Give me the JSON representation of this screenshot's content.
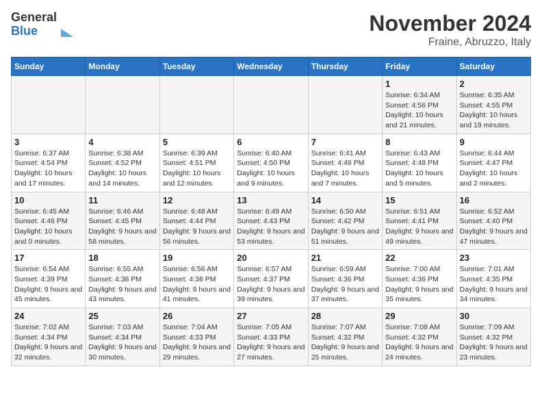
{
  "header": {
    "logo_general": "General",
    "logo_blue": "Blue",
    "title": "November 2024",
    "subtitle": "Fraine, Abruzzo, Italy"
  },
  "calendar": {
    "days_of_week": [
      "Sunday",
      "Monday",
      "Tuesday",
      "Wednesday",
      "Thursday",
      "Friday",
      "Saturday"
    ],
    "weeks": [
      [
        {
          "day": "",
          "info": ""
        },
        {
          "day": "",
          "info": ""
        },
        {
          "day": "",
          "info": ""
        },
        {
          "day": "",
          "info": ""
        },
        {
          "day": "",
          "info": ""
        },
        {
          "day": "1",
          "info": "Sunrise: 6:34 AM\nSunset: 4:56 PM\nDaylight: 10 hours and 21 minutes."
        },
        {
          "day": "2",
          "info": "Sunrise: 6:35 AM\nSunset: 4:55 PM\nDaylight: 10 hours and 19 minutes."
        }
      ],
      [
        {
          "day": "3",
          "info": "Sunrise: 6:37 AM\nSunset: 4:54 PM\nDaylight: 10 hours and 17 minutes."
        },
        {
          "day": "4",
          "info": "Sunrise: 6:38 AM\nSunset: 4:52 PM\nDaylight: 10 hours and 14 minutes."
        },
        {
          "day": "5",
          "info": "Sunrise: 6:39 AM\nSunset: 4:51 PM\nDaylight: 10 hours and 12 minutes."
        },
        {
          "day": "6",
          "info": "Sunrise: 6:40 AM\nSunset: 4:50 PM\nDaylight: 10 hours and 9 minutes."
        },
        {
          "day": "7",
          "info": "Sunrise: 6:41 AM\nSunset: 4:49 PM\nDaylight: 10 hours and 7 minutes."
        },
        {
          "day": "8",
          "info": "Sunrise: 6:43 AM\nSunset: 4:48 PM\nDaylight: 10 hours and 5 minutes."
        },
        {
          "day": "9",
          "info": "Sunrise: 6:44 AM\nSunset: 4:47 PM\nDaylight: 10 hours and 2 minutes."
        }
      ],
      [
        {
          "day": "10",
          "info": "Sunrise: 6:45 AM\nSunset: 4:46 PM\nDaylight: 10 hours and 0 minutes."
        },
        {
          "day": "11",
          "info": "Sunrise: 6:46 AM\nSunset: 4:45 PM\nDaylight: 9 hours and 58 minutes."
        },
        {
          "day": "12",
          "info": "Sunrise: 6:48 AM\nSunset: 4:44 PM\nDaylight: 9 hours and 56 minutes."
        },
        {
          "day": "13",
          "info": "Sunrise: 6:49 AM\nSunset: 4:43 PM\nDaylight: 9 hours and 53 minutes."
        },
        {
          "day": "14",
          "info": "Sunrise: 6:50 AM\nSunset: 4:42 PM\nDaylight: 9 hours and 51 minutes."
        },
        {
          "day": "15",
          "info": "Sunrise: 6:51 AM\nSunset: 4:41 PM\nDaylight: 9 hours and 49 minutes."
        },
        {
          "day": "16",
          "info": "Sunrise: 6:52 AM\nSunset: 4:40 PM\nDaylight: 9 hours and 47 minutes."
        }
      ],
      [
        {
          "day": "17",
          "info": "Sunrise: 6:54 AM\nSunset: 4:39 PM\nDaylight: 9 hours and 45 minutes."
        },
        {
          "day": "18",
          "info": "Sunrise: 6:55 AM\nSunset: 4:38 PM\nDaylight: 9 hours and 43 minutes."
        },
        {
          "day": "19",
          "info": "Sunrise: 6:56 AM\nSunset: 4:38 PM\nDaylight: 9 hours and 41 minutes."
        },
        {
          "day": "20",
          "info": "Sunrise: 6:57 AM\nSunset: 4:37 PM\nDaylight: 9 hours and 39 minutes."
        },
        {
          "day": "21",
          "info": "Sunrise: 6:59 AM\nSunset: 4:36 PM\nDaylight: 9 hours and 37 minutes."
        },
        {
          "day": "22",
          "info": "Sunrise: 7:00 AM\nSunset: 4:36 PM\nDaylight: 9 hours and 35 minutes."
        },
        {
          "day": "23",
          "info": "Sunrise: 7:01 AM\nSunset: 4:35 PM\nDaylight: 9 hours and 34 minutes."
        }
      ],
      [
        {
          "day": "24",
          "info": "Sunrise: 7:02 AM\nSunset: 4:34 PM\nDaylight: 9 hours and 32 minutes."
        },
        {
          "day": "25",
          "info": "Sunrise: 7:03 AM\nSunset: 4:34 PM\nDaylight: 9 hours and 30 minutes."
        },
        {
          "day": "26",
          "info": "Sunrise: 7:04 AM\nSunset: 4:33 PM\nDaylight: 9 hours and 29 minutes."
        },
        {
          "day": "27",
          "info": "Sunrise: 7:05 AM\nSunset: 4:33 PM\nDaylight: 9 hours and 27 minutes."
        },
        {
          "day": "28",
          "info": "Sunrise: 7:07 AM\nSunset: 4:32 PM\nDaylight: 9 hours and 25 minutes."
        },
        {
          "day": "29",
          "info": "Sunrise: 7:08 AM\nSunset: 4:32 PM\nDaylight: 9 hours and 24 minutes."
        },
        {
          "day": "30",
          "info": "Sunrise: 7:09 AM\nSunset: 4:32 PM\nDaylight: 9 hours and 23 minutes."
        }
      ]
    ]
  }
}
